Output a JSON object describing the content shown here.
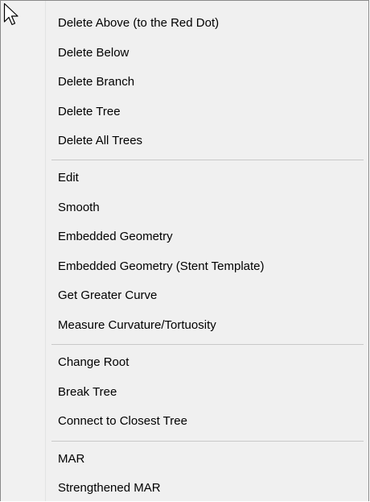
{
  "context_menu": {
    "items": [
      {
        "label": "Delete Above (to the Red Dot)"
      },
      {
        "label": "Delete Below"
      },
      {
        "label": "Delete Branch"
      },
      {
        "label": "Delete Tree"
      },
      {
        "label": "Delete All Trees"
      },
      {
        "label": "Edit"
      },
      {
        "label": "Smooth"
      },
      {
        "label": "Embedded Geometry"
      },
      {
        "label": "Embedded Geometry (Stent Template)"
      },
      {
        "label": "Get Greater Curve"
      },
      {
        "label": "Measure Curvature/Tortuosity"
      },
      {
        "label": "Change Root"
      },
      {
        "label": "Break Tree"
      },
      {
        "label": "Connect to Closest Tree"
      },
      {
        "label": "MAR"
      },
      {
        "label": "Strengthened MAR"
      }
    ]
  },
  "icons": {
    "cursor": "mouse-pointer-icon"
  },
  "colors": {
    "menu_background": "#f0f0f0",
    "separator": "#c8c8c8",
    "border": "#8a8a8a",
    "text": "#000000"
  }
}
